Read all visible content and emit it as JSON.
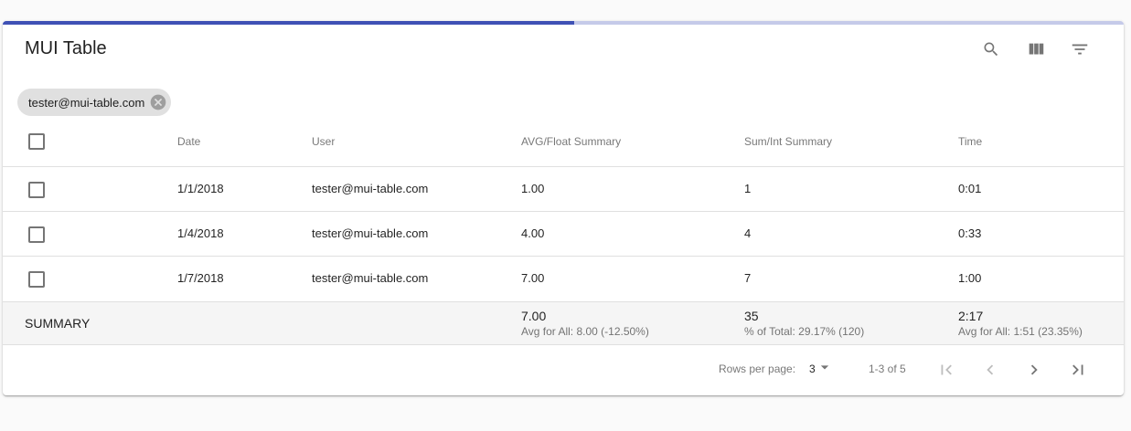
{
  "table": {
    "title": "MUI Table",
    "load_progress_percent": 51,
    "toolbar_icons": [
      "search-icon",
      "view-column-icon",
      "filter-list-icon"
    ],
    "filter_chip": {
      "label": "tester@mui-table.com",
      "icon": "cancel-icon"
    },
    "columns": [
      "Date",
      "User",
      "AVG/Float Summary",
      "Sum/Int Summary",
      "Time"
    ],
    "rows": [
      {
        "date": "1/1/2018",
        "user": "tester@mui-table.com",
        "avg": "1.00",
        "sum": "1",
        "time": "0:01"
      },
      {
        "date": "1/4/2018",
        "user": "tester@mui-table.com",
        "avg": "4.00",
        "sum": "4",
        "time": "0:33"
      },
      {
        "date": "1/7/2018",
        "user": "tester@mui-table.com",
        "avg": "7.00",
        "sum": "7",
        "time": "1:00"
      }
    ],
    "summary": {
      "label": "SUMMARY",
      "avg_value": "7.00",
      "avg_note": "Avg for All: 8.00 (-12.50%)",
      "sum_value": "35",
      "sum_note": "% of Total: 29.17% (120)",
      "time_value": "2:17",
      "time_note": "Avg for All: 1:51 (23.35%)"
    },
    "pagination": {
      "rows_per_page_label": "Rows per page:",
      "rows_per_page": "3",
      "range": "1-3 of 5",
      "icons": [
        "first-page-icon",
        "chevron-left-icon",
        "chevron-right-icon",
        "last-page-icon"
      ]
    }
  },
  "colors": {
    "primary": "#3f51b5",
    "progress_track": "#c5cae9",
    "summary_bg": "#f5f5f5",
    "chip_bg": "#e0e0e0"
  }
}
